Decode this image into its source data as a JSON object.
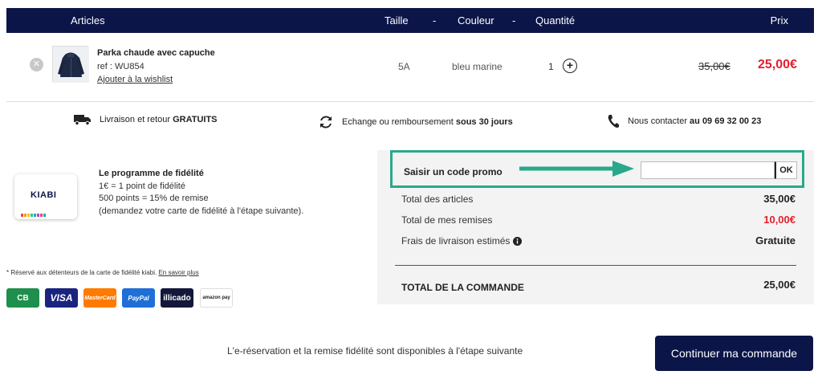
{
  "header": {
    "articles": "Articles",
    "taille": "Taille",
    "dash": "-",
    "couleur": "Couleur",
    "quantite": "Quantité",
    "prix": "Prix"
  },
  "item": {
    "name": "Parka chaude avec capuche",
    "ref": "ref : WU854",
    "wishlist": "Ajouter à la wishlist",
    "size": "5A",
    "color": "bleu marine",
    "quantity": "1",
    "old_price": "35,00€",
    "new_price": "25,00€"
  },
  "perks": {
    "delivery_text": "Livraison et retour ",
    "delivery_bold": "GRATUITS",
    "exchange_text": "Echange ou remboursement ",
    "exchange_bold": "sous 30 jours",
    "contact_text": "Nous contacter ",
    "contact_bold": "au 09 69 32 00 23"
  },
  "loyalty": {
    "card_brand": "KIABI",
    "title": "Le programme de fidélité",
    "lines": [
      "1€ = 1 point de fidélité",
      "500 points = 15% de remise",
      "(demandez votre carte de fidélité à l'étape suivante)."
    ],
    "note": "* Réservé aux détenteurs de la carte de fidélité kiabi.",
    "note_link": "En savoir plus"
  },
  "payments": {
    "cb": "CB",
    "visa": "VISA",
    "mastercard": "MasterCard",
    "paypal": "PayPal",
    "illicado": "illicado",
    "amazon": "amazon pay"
  },
  "summary": {
    "promo_label": "Saisir un code promo",
    "promo_placeholder": "",
    "promo_ok": "OK",
    "articles_label": "Total des articles",
    "articles_value": "35,00€",
    "discounts_label": "Total de mes remises",
    "discounts_value": "10,00€",
    "shipping_label": "Frais de livraison estimés",
    "shipping_value": "Gratuite",
    "total_label": "TOTAL DE LA COMMANDE",
    "total_value": "25,00€"
  },
  "footer": {
    "note": "L'e-réservation et la remise fidélité sont disponibles à l'étape suivante",
    "cta": "Continuer ma commande"
  },
  "colors": {
    "navy": "#0b1548",
    "accent_green": "#2aa88a",
    "price_red": "#e0212e"
  }
}
